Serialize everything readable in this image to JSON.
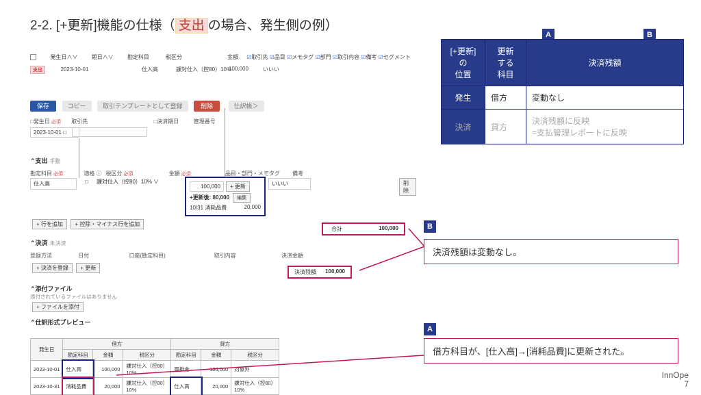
{
  "title_prefix": "2-2. [+更新]機能の仕様（",
  "title_red": "支出",
  "title_suffix": "の場合、発生側の例）",
  "badge_a": "A",
  "badge_b": "B",
  "side_table": {
    "h1": "[+更新]\nの\n位置",
    "h2": "更新\nする\n科目",
    "h3": "決済残額",
    "r1c1": "発生",
    "r1c2": "借方",
    "r1c3": "変動なし",
    "r2c1": "決済",
    "r2c2": "貸方",
    "r2c3a": "決済残額に反映",
    "r2c3b": "=支払管理レポートに反映"
  },
  "filter": {
    "c1": "発生日∧∨",
    "c2": "期日∧∨",
    "c3": "勘定科目",
    "c4": "税区分",
    "c5": "金額",
    "chk1": "取引先",
    "chk2": "品目",
    "chk3": "メモタグ",
    "chk4": "部門",
    "chk5": "取引内容",
    "chk6": "備考",
    "chk7": "セグメント"
  },
  "datarow": {
    "tag": "支出",
    "date": "2023-10-01",
    "acct": "仕入高",
    "tax": "課対仕入（控80）10%",
    "amt": "100,000",
    "memo": "いいい"
  },
  "btns": {
    "save": "保存",
    "copy": "コピー",
    "tmpl": "取引テンプレートとして登録",
    "del": "削除",
    "journal": "仕訳帳＞"
  },
  "form": {
    "l1": "□発生日",
    "l2": "取引先",
    "l3": "□決済期日",
    "l4": "管理番号",
    "date": "2023-10-01 □"
  },
  "sec1": {
    "hdr": "⌃支出",
    "sub": "手動"
  },
  "exp_hdr": {
    "c1": "勘定科目",
    "c2": "適格",
    "c3": "税区分",
    "c4": "金額",
    "c5": "品目・部門・メモタグ",
    "c6": "備考"
  },
  "exp_row": {
    "acct": "仕入高",
    "elig": "□",
    "tax": "課対仕入（控80）10%  ∨",
    "amt": "100,000",
    "upd": "+ 更新",
    "memo": "いいい",
    "del": "削除"
  },
  "upd_box": {
    "l1a": "+更新後: 80,000",
    "l1b": "編集",
    "l2a": "10/31 消耗品費",
    "l2b": "20,000"
  },
  "add": {
    "b1": "+ 行を追加",
    "b2": "+ 控除・マイナス行を追加"
  },
  "total": {
    "lbl": "合計",
    "amt": "100,000"
  },
  "sec2": {
    "hdr": "⌃決済",
    "sub": "未決済"
  },
  "settle_hdr": {
    "c1": "登録方法",
    "c2": "日付",
    "c3": "口座(勘定科目)",
    "c4": "取引内容",
    "c5": "決済金額"
  },
  "settle_row": {
    "b1": "+ 決済を登録",
    "b2": "+ 更新"
  },
  "bal": {
    "lbl": "決済残額",
    "amt": "100,000"
  },
  "attach": {
    "h": "⌃添付ファイル",
    "sub": "添付されているファイルはありません",
    "b": "+ ファイルを添付"
  },
  "preview": {
    "h": "⌃仕訳形式プレビュー"
  },
  "jtbl": {
    "h_date": "発生日",
    "h_dr": "借方",
    "h_cr": "貸方",
    "h_acct": "勘定科目",
    "h_amt": "金額",
    "h_tax": "税区分",
    "r1": {
      "date": "2023-10-01",
      "dr_acct": "仕入高",
      "dr_amt": "100,000",
      "dr_tax": "課対仕入（控80）\n10%",
      "cr_acct": "買掛金",
      "cr_amt": "100,000",
      "cr_tax": "対象外"
    },
    "r2": {
      "date": "2023-10-31",
      "dr_acct": "消耗品費",
      "dr_amt": "20,000",
      "dr_tax": "課対仕入（控80）\n10%",
      "cr_acct": "仕入高",
      "cr_amt": "20,000",
      "cr_tax": "課対仕入（控80）\n10%"
    }
  },
  "annot1": "決済残額は変動なし。",
  "annot2": "借方科目が、[仕入高]→[消耗品費]に更新された。",
  "footer_a": "InnOpe",
  "footer_b": "7"
}
